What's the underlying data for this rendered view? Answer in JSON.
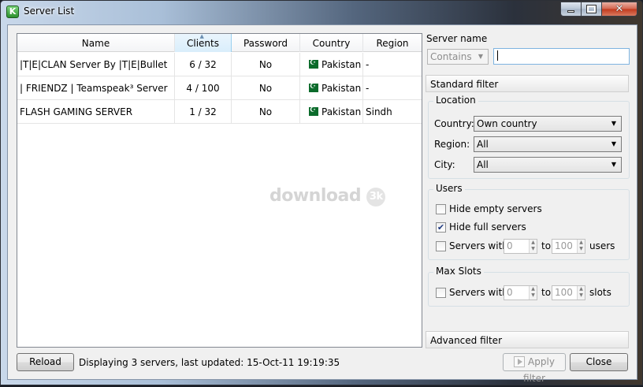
{
  "window": {
    "title": "Server List"
  },
  "list": {
    "columns": [
      "Name",
      "Clients",
      "Password",
      "Country",
      "Region"
    ],
    "rows": [
      {
        "name": "|T|E|CLAN Server By |T|E|Bullet",
        "clients": "6 / 32",
        "password": "No",
        "country": "Pakistan",
        "region": "-"
      },
      {
        "name": "|  FRIENDZ  | Teamspeak³ Server",
        "clients": "4 / 100",
        "password": "No",
        "country": "Pakistan",
        "region": "-"
      },
      {
        "name": "FLASH GAMING SERVER",
        "clients": "1 / 32",
        "password": "No",
        "country": "Pakistan",
        "region": "Sindh"
      }
    ],
    "watermark": "download"
  },
  "filter": {
    "server_name_label": "Server name",
    "match_mode": "Contains",
    "search_value": "",
    "standard_filter": "Standard filter",
    "location": {
      "title": "Location",
      "country_label": "Country:",
      "country_value": "Own country",
      "region_label": "Region:",
      "region_value": "All",
      "city_label": "City:",
      "city_value": "All"
    },
    "users": {
      "title": "Users",
      "hide_empty": "Hide empty servers",
      "hide_empty_checked": false,
      "hide_full": "Hide full servers",
      "hide_full_checked": true,
      "servers_with": "Servers with",
      "servers_with_checked": false,
      "from": "0",
      "to_label": "to",
      "to": "100",
      "unit": "users"
    },
    "max_slots": {
      "title": "Max Slots",
      "servers_with": "Servers with",
      "servers_with_checked": false,
      "from": "0",
      "to_label": "to",
      "to": "100",
      "unit": "slots"
    },
    "advanced_filter": "Advanced filter"
  },
  "footer": {
    "reload": "Reload",
    "status": "Displaying 3 servers, last updated: 15-Oct-11 19:19:35",
    "apply": "Apply filter",
    "close": "Close"
  },
  "icons": [
    "app-icon",
    "minimize-icon",
    "maximize-icon",
    "close-icon",
    "pakistan-flag-icon",
    "dropdown-arrow-icon",
    "checkmark-icon",
    "spinner-arrows-icon",
    "apply-filter-icon"
  ]
}
